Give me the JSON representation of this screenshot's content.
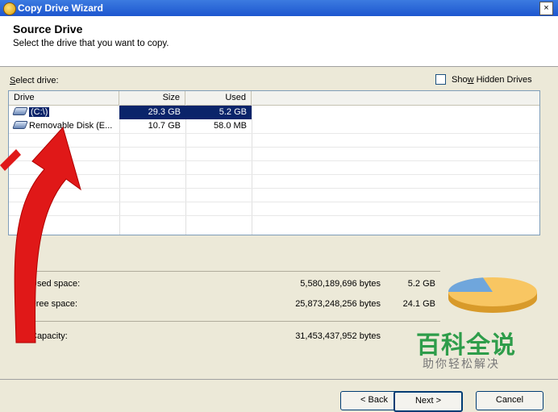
{
  "window": {
    "title": "Copy Drive Wizard",
    "close_label": "×"
  },
  "header": {
    "title": "Source Drive",
    "subtitle": "Select the drive that you want to copy."
  },
  "select_label_underline": "S",
  "select_label_rest": "elect drive:",
  "show_hidden_underline": "w",
  "show_hidden_pre": "Sho",
  "show_hidden_post": " Hidden Drives",
  "columns": {
    "drive": "Drive",
    "size": "Size",
    "used": "Used"
  },
  "drives": [
    {
      "name": "(C:\\)",
      "size": "29.3 GB",
      "used": "5.2 GB",
      "selected": true
    },
    {
      "name": "Removable Disk (E...",
      "size": "10.7 GB",
      "used": "58.0 MB",
      "selected": false
    }
  ],
  "space": {
    "used": {
      "label": "Used space:",
      "bytes": "5,580,189,696 bytes",
      "size": "5.2 GB"
    },
    "free": {
      "label": "Free space:",
      "bytes": "25,873,248,256 bytes",
      "size": "24.1 GB"
    },
    "capacity": {
      "label": "Capacity:",
      "bytes": "31,453,437,952 bytes"
    }
  },
  "pie_colors": {
    "used": "#6fa6dc",
    "free": "#f8c662"
  },
  "watermark": {
    "main": "百科全说",
    "sub": "助你轻松解决"
  },
  "buttons": {
    "back": "< Back",
    "next": "Next >",
    "cancel": "Cancel"
  },
  "colors": {
    "title_bar": "#1d56cf",
    "selection": "#0a246a",
    "annotation_arrow": "#e01818"
  }
}
